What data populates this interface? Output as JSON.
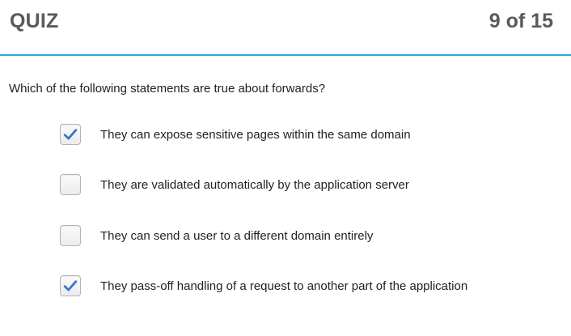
{
  "header": {
    "title": "QUIZ",
    "progress": "9 of 15"
  },
  "accent_color": "#2aa9dd",
  "check_color": "#3a78c2",
  "question": {
    "text": "Which of the following statements are true about forwards?"
  },
  "options": [
    {
      "label": "They can expose sensitive pages within the same domain",
      "checked": true
    },
    {
      "label": "They are validated automatically by the application server",
      "checked": false
    },
    {
      "label": "They can send a user to a different domain entirely",
      "checked": false
    },
    {
      "label": "They pass-off handling of a request to another part of the application",
      "checked": true
    }
  ],
  "icons": {
    "checked": "checkmark-icon"
  }
}
